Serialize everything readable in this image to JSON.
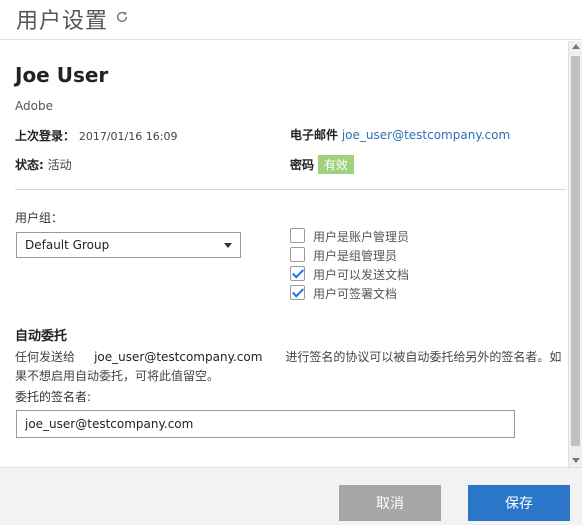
{
  "header": {
    "title": "用户设置",
    "refresh_icon": "refresh-icon"
  },
  "user": {
    "name": "Joe User",
    "company": "Adobe",
    "last_login_label": "上次登录：",
    "last_login_value": "2017/01/16 16:09",
    "email_label": "电子邮件",
    "email_value": "joe_user@testcompany.com",
    "status_label": "状态:",
    "status_value": "活动",
    "password_label": "密码",
    "password_value": "有效"
  },
  "groups": {
    "label": "用户组：",
    "selected": "Default Group",
    "permissions": [
      {
        "label": "用户是账户管理员",
        "checked": false
      },
      {
        "label": "用户是组管理员",
        "checked": false
      },
      {
        "label": "用户可以发送文档",
        "checked": true
      },
      {
        "label": "用户可签署文档",
        "checked": true
      }
    ]
  },
  "auto_delegate": {
    "title": "自动委托",
    "desc_prefix": "任何发送给",
    "desc_email": "joe_user@testcompany.com",
    "desc_suffix": "进行签名的协议可以被自动委托给另外的签名者。如果不想启用自动委托，可将此值留空。",
    "delegate_label": "委托的签名者:",
    "delegate_value": "joe_user@testcompany.com"
  },
  "footer": {
    "cancel_label": "取消",
    "save_label": "保存"
  },
  "colors": {
    "accent": "#2c76c9",
    "badge": "#9fd27d",
    "cancel": "#a6a6a6"
  }
}
